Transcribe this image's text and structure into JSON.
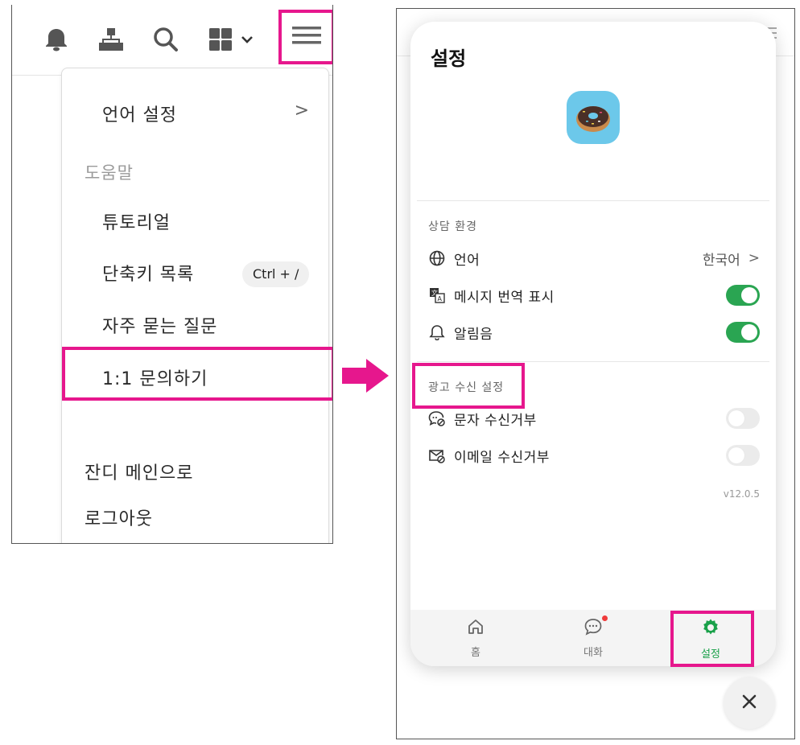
{
  "left": {
    "toolbar": {
      "icons": [
        "bell-icon",
        "org-chart-icon",
        "search-icon",
        "grid-icon",
        "chevron-down-icon",
        "hamburger-icon"
      ]
    },
    "menu": {
      "language": "언어 설정",
      "language_chevron": ">",
      "help_section": "도움말",
      "tutorial": "튜토리얼",
      "shortcuts": "단축키 목록",
      "shortcuts_key": "Ctrl + /",
      "faq": "자주 묻는 질문",
      "inquiry": "1:1 문의하기",
      "jandi_main": "잔디 메인으로",
      "logout": "로그아웃"
    }
  },
  "right": {
    "title": "설정",
    "logo_icon": "donut-icon",
    "consult_section": "상담 환경",
    "language_label": "언어",
    "language_value": "한국어",
    "language_chevron": ">",
    "translate_label": "메시지 번역 표시",
    "translate_on": true,
    "sound_label": "알림음",
    "sound_on": true,
    "ad_section": "광고 수신 설정",
    "sms_label": "문자 수신거부",
    "sms_on": false,
    "email_label": "이메일 수신거부",
    "email_on": false,
    "version": "v12.0.5",
    "nav": {
      "home": "홈",
      "chat": "대화",
      "settings": "설정"
    },
    "close_icon": "close-icon"
  },
  "colors": {
    "highlight": "#e6178d",
    "toggle_on": "#2aa552",
    "active_nav": "#1aa14a",
    "logo_bg": "#6cc8ea"
  }
}
